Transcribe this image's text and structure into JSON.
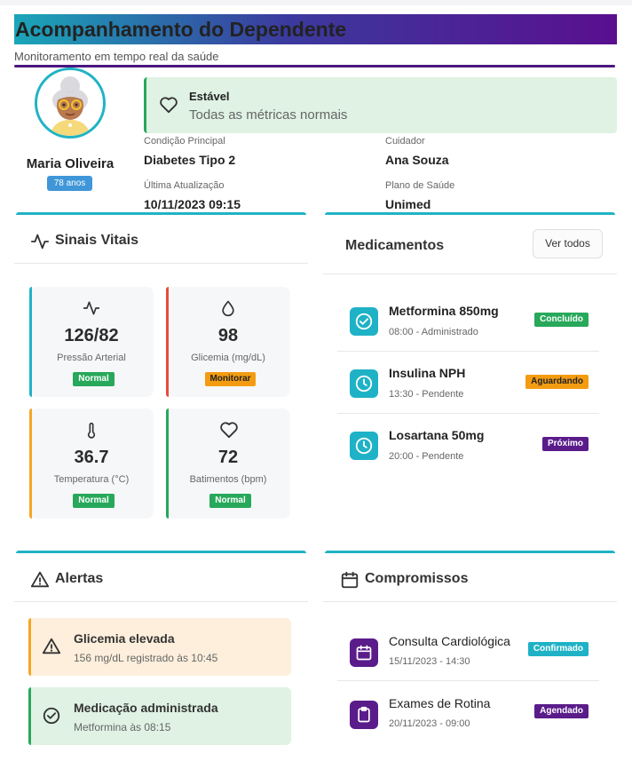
{
  "header": {
    "title": "Acompanhamento do Dependente",
    "subtitle": "Monitoramento em tempo real da saúde"
  },
  "profile": {
    "name": "Maria Oliveira",
    "age": "78 anos",
    "status": {
      "title": "Estável",
      "description": "Todas as métricas normais"
    },
    "info": [
      {
        "label": "Condição Principal",
        "value": "Diabetes Tipo 2"
      },
      {
        "label": "Cuidador",
        "value": "Ana Souza"
      },
      {
        "label": "Última Atualização",
        "value": "10/11/2023 09:15"
      },
      {
        "label": "Plano de Saúde",
        "value": "Unimed"
      }
    ]
  },
  "vitals": {
    "title": "Sinais Vitais",
    "items": [
      {
        "value": "126/82",
        "label": "Pressão Arterial",
        "status": "Normal",
        "icon": "activity-icon",
        "accent": "#20b3c4",
        "badge_color": "#27a85a"
      },
      {
        "value": "98",
        "label": "Glicemia (mg/dL)",
        "status": "Monitorar",
        "icon": "droplet-icon",
        "accent": "#e74c3c",
        "badge_color": "#f39c12"
      },
      {
        "value": "36.7",
        "label": "Temperatura (°C)",
        "status": "Normal",
        "icon": "thermometer-icon",
        "accent": "#f5a623",
        "badge_color": "#27a85a"
      },
      {
        "value": "72",
        "label": "Batimentos (bpm)",
        "status": "Normal",
        "icon": "heart-icon",
        "accent": "#27a85a",
        "badge_color": "#27a85a"
      }
    ]
  },
  "medications": {
    "title": "Medicamentos",
    "view_all": "Ver todos",
    "items": [
      {
        "name": "Metformina 850mg",
        "time": "08:00 - Administrado",
        "status": "Concluído",
        "badge_color": "#27a85a",
        "icon": "check-circle-icon"
      },
      {
        "name": "Insulina NPH",
        "time": "13:30 - Pendente",
        "status": "Aguardando",
        "badge_color": "#f39c12",
        "icon": "clock-icon"
      },
      {
        "name": "Losartana 50mg",
        "time": "20:00 - Pendente",
        "status": "Próximo",
        "badge_color": "#5a1c8a",
        "icon": "clock-icon"
      }
    ]
  },
  "alerts": {
    "title": "Alertas",
    "items": [
      {
        "title": "Glicemia elevada",
        "description": "156 mg/dL registrado às 10:45",
        "bg": "#fdefdc",
        "accent": "#f5a623",
        "icon": "warning-icon"
      },
      {
        "title": "Medicação administrada",
        "description": "Metformina às 08:15",
        "bg": "#dff2e4",
        "accent": "#27a85a",
        "icon": "check-circle-icon"
      }
    ]
  },
  "appointments": {
    "title": "Compromissos",
    "items": [
      {
        "name": "Consulta Cardiológica",
        "time": "15/11/2023 - 14:30",
        "status": "Confirmado",
        "badge_color": "#1fb2c6",
        "icon": "calendar-icon"
      },
      {
        "name": "Exames de Rotina",
        "time": "20/11/2023 - 09:00",
        "status": "Agendado",
        "badge_color": "#5a1c8a",
        "icon": "clipboard-icon"
      }
    ]
  }
}
